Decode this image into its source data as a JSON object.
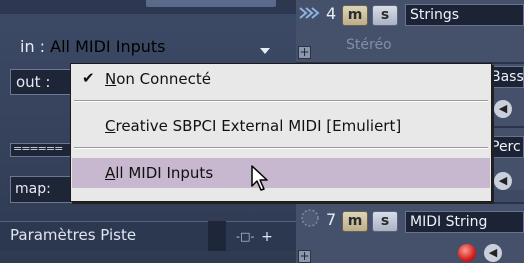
{
  "inspector": {
    "in_label": "in :",
    "in_value": "All MIDI Inputs",
    "out_label": "out :",
    "equals_text": "======",
    "map_label": "map:",
    "params_label": "Paramètres Piste",
    "params_icon": "-□-",
    "params_plus": "+"
  },
  "tracks": {
    "track4": {
      "number": "4",
      "mute": "m",
      "solo": "s",
      "name": "Strings",
      "output": "Stéréo"
    },
    "track5_name": "Bass",
    "track6_name": "Perc",
    "track7": {
      "number": "7",
      "mute": "m",
      "solo": "s",
      "name": "MIDI String"
    },
    "plus": "+"
  },
  "menu": {
    "items": [
      {
        "label_u": "N",
        "label_rest": "on Connecté",
        "checked": true
      },
      {
        "label_u": "C",
        "label_rest": "reative SBPCI External MIDI [Emuliert]",
        "checked": false
      },
      {
        "label_u": "A",
        "label_rest": "ll MIDI Inputs",
        "checked": false
      }
    ],
    "check_mark": "✔"
  },
  "colors": {
    "panel": "#3d4a66",
    "menu_bg": "#e8e8e8",
    "menu_highlight": "#c7b8cf",
    "record": "#d01f1f"
  }
}
